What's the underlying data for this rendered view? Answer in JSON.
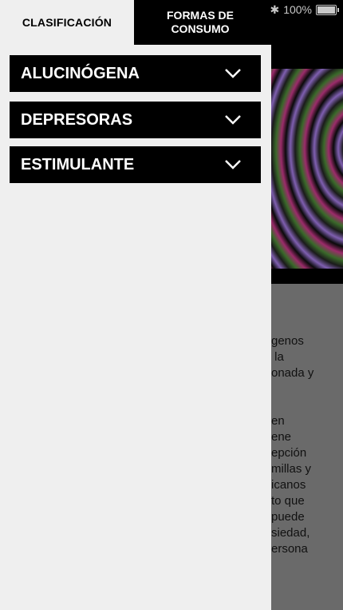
{
  "status_bar": {
    "battery_text": "100%",
    "icons": [
      "bluetooth-icon",
      "battery-icon"
    ]
  },
  "tabs": {
    "left_label": "CLASIFICACIÓN",
    "right_label": "FORMAS DE\nCONSUMO"
  },
  "accordion": [
    {
      "label": "ALUCINÓGENA"
    },
    {
      "label": "DEPRESORAS"
    },
    {
      "label": "ESTIMULANTE"
    }
  ],
  "background_text_lines": [
    "genos",
    " la",
    "onada y",
    "",
    "en",
    "ene",
    "epción",
    "millas y",
    "icanos",
    "to que",
    "puede",
    "siedad,",
    "ersona"
  ]
}
